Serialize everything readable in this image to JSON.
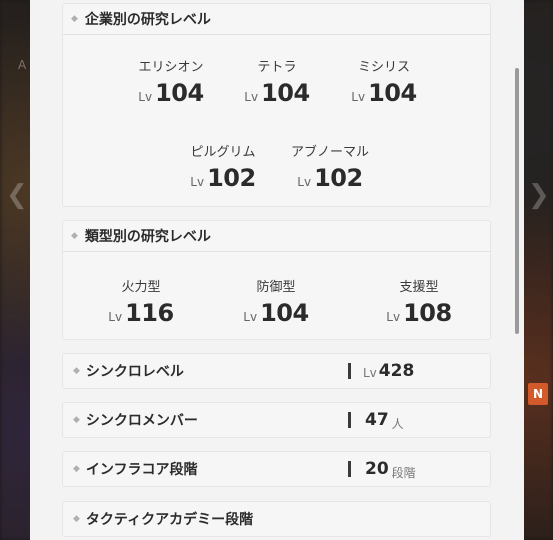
{
  "background": {
    "left_glyph": "❮",
    "right_glyph": "❯",
    "tag": "N",
    "side_text": "A"
  },
  "company_research": {
    "title": "企業別の研究レベル",
    "level_prefix": "Lv",
    "items": [
      {
        "name": "エリシオン",
        "level": "104"
      },
      {
        "name": "テトラ",
        "level": "104"
      },
      {
        "name": "ミシリス",
        "level": "104"
      },
      {
        "name": "ピルグリム",
        "level": "102"
      },
      {
        "name": "アブノーマル",
        "level": "102"
      }
    ]
  },
  "type_research": {
    "title": "類型別の研究レベル",
    "level_prefix": "Lv",
    "items": [
      {
        "name": "火力型",
        "level": "116"
      },
      {
        "name": "防御型",
        "level": "104"
      },
      {
        "name": "支援型",
        "level": "108"
      }
    ]
  },
  "stats": [
    {
      "label": "シンクロレベル",
      "prefix": "Lv",
      "value": "428",
      "suffix": ""
    },
    {
      "label": "シンクロメンバー",
      "prefix": "",
      "value": "47",
      "suffix": "人"
    },
    {
      "label": "インフラコア段階",
      "prefix": "",
      "value": "20",
      "suffix": "段階"
    },
    {
      "label": "タクティクアカデミー段階",
      "prefix": "",
      "value": "",
      "suffix": ""
    }
  ]
}
